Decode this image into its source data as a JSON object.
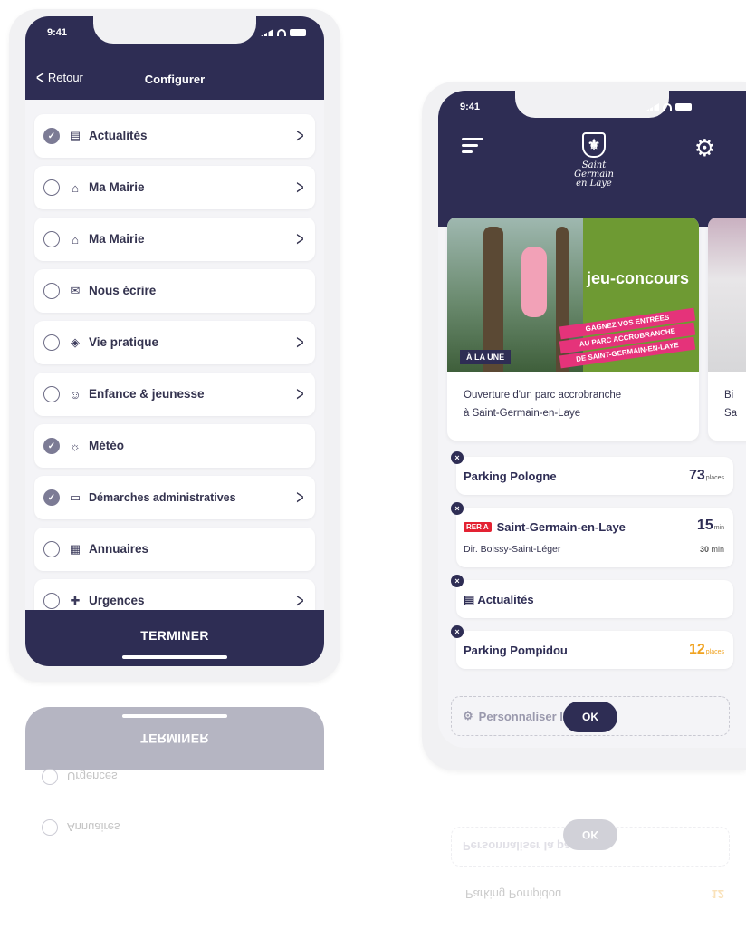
{
  "left_phone": {
    "status_time": "9:41",
    "back_label": "Retour",
    "title": "Configurer",
    "items": [
      {
        "label": "Actualités",
        "icon": "newspaper-icon",
        "glyph": "▤",
        "checked": true,
        "chevron": true
      },
      {
        "label": "Ma Mairie",
        "icon": "city-hall-icon",
        "glyph": "⌂",
        "checked": false,
        "chevron": true
      },
      {
        "label": "Ma Mairie",
        "icon": "city-hall-icon",
        "glyph": "⌂",
        "checked": false,
        "chevron": true
      },
      {
        "label": "Nous écrire",
        "icon": "message-icon",
        "glyph": "✉",
        "checked": false,
        "chevron": false
      },
      {
        "label": "Vie pratique",
        "icon": "shield-icon",
        "glyph": "◈",
        "checked": false,
        "chevron": true
      },
      {
        "label": "Enfance & jeunesse",
        "icon": "family-icon",
        "glyph": "☺",
        "checked": false,
        "chevron": true
      },
      {
        "label": "Météo",
        "icon": "sun-icon",
        "glyph": "☼",
        "checked": true,
        "chevron": false
      },
      {
        "label": "Démarches administratives",
        "icon": "documents-icon",
        "glyph": "▭",
        "checked": true,
        "chevron": true
      },
      {
        "label": "Annuaires",
        "icon": "directory-icon",
        "glyph": "▦",
        "checked": false,
        "chevron": false
      },
      {
        "label": "Urgences",
        "icon": "emergency-icon",
        "glyph": "✚",
        "checked": false,
        "chevron": true
      }
    ],
    "footer_button": "TERMINER"
  },
  "right_phone": {
    "status_time": "9:41",
    "logo_lines": [
      "Saint",
      "Germain",
      "en Laye"
    ],
    "cards": [
      {
        "badge": "À LA UNE",
        "promo_title": "jeu-concours",
        "promo_lines": [
          "GAGNEZ VOS ENTRÉES",
          "AU PARC ACCROBRANCHE",
          "DE SAINT-GERMAIN-EN-LAYE"
        ],
        "text_line1": "Ouverture d'un parc accrobranche",
        "text_line2": "à Saint-Germain-en-Laye"
      },
      {
        "text_line1": "Bi",
        "text_line2": "Sa"
      }
    ],
    "widgets": {
      "parking1": {
        "name": "Parking Pologne",
        "count": "73",
        "unit": "places"
      },
      "rer": {
        "badge": "RER A",
        "station": "Saint-Germain-en-Laye",
        "direction": "Dir. Boissy-Saint-Léger",
        "next": "15",
        "next_unit": "min",
        "after": "30",
        "after_unit": "min"
      },
      "news": {
        "label": "Actualités"
      },
      "parking2": {
        "name": "Parking Pompidou",
        "count": "12",
        "unit": "places",
        "count_color": "#f0a21f"
      }
    },
    "personalize_label": "Personnaliser la page",
    "ok_label": "OK"
  },
  "colors": {
    "navy": "#2e2d54",
    "rer_red": "#e32232",
    "warning_orange": "#f0a21f"
  }
}
